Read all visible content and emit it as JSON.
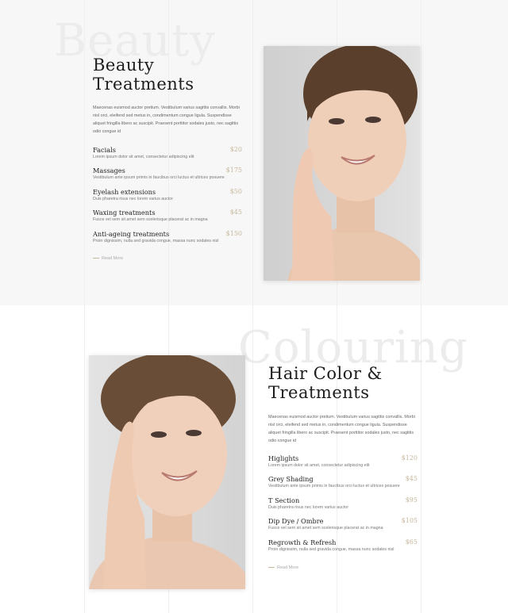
{
  "beauty": {
    "ghost_word": "Beauty",
    "title_line1": "Beauty",
    "title_line2": "Treatments",
    "intro": "Maecenas euismod auctor pretium. Vestibulum varius sagittis convallis. Morbi nisl orci, eleifend sed metus in, condimentum congue ligula. Suspendisse aliquet fringilla libero ac suscipit. Praesent porttitor sodales justo, nec sagittis odio congue id",
    "items": [
      {
        "name": "Facials",
        "price": "$20",
        "desc": "Lorem ipsum dolor sit amet, consectetur adipiscing elit"
      },
      {
        "name": "Massages",
        "price": "$175",
        "desc": "Vestibulum ante ipsum primis in faucibus orci luctus et ultrices posuere"
      },
      {
        "name": "Eyelash extensions",
        "price": "$50",
        "desc": "Duis pharetra risus nec lorem varius auctor"
      },
      {
        "name": "Waxing treatments",
        "price": "$45",
        "desc": "Fusce vel sem sit amet sem scelerisque placerat ac in magna"
      },
      {
        "name": "Anti-ageing treatments",
        "price": "$150",
        "desc": "Proin dignissim, nulla sed gravida congue, massa nunc sodales nisl"
      }
    ],
    "read_more": "Read More"
  },
  "colouring": {
    "ghost_word": "Colouring",
    "title_line1": "Hair Color &",
    "title_line2": "Treatments",
    "intro": "Maecenas euismod auctor pretium. Vestibulum varius sagittis convallis. Morbi nisl orci, eleifend sed metus in, condimentum congue ligula. Suspendisse aliquet fringilla libero ac suscipit. Praesent porttitor sodales justo, nec sagittis odio congue id",
    "items": [
      {
        "name": "Higlights",
        "price": "$120",
        "desc": "Lorem ipsum dolor sit amet, consectetur adipiscing elit"
      },
      {
        "name": "Grey Shading",
        "price": "$45",
        "desc": "Vestibulum ante ipsum primis in faucibus orci luctus et ultrices posuere"
      },
      {
        "name": "T Section",
        "price": "$95",
        "desc": "Duis pharetra risus nec lorem varius auctor"
      },
      {
        "name": "Dip Dye / Ombre",
        "price": "$105",
        "desc": "Fusce vel sem sit amet sem scelerisque placerat ac in magna"
      },
      {
        "name": "Regrowth & Refresh",
        "price": "$65",
        "desc": "Proin dignissim, nulla sed gravida congue, massa nunc sodales nisl"
      }
    ],
    "read_more": "Read More"
  },
  "colors": {
    "accent": "#c6b79d",
    "section1_bg": "#f7f7f7",
    "section2_bg": "#ffffff"
  }
}
